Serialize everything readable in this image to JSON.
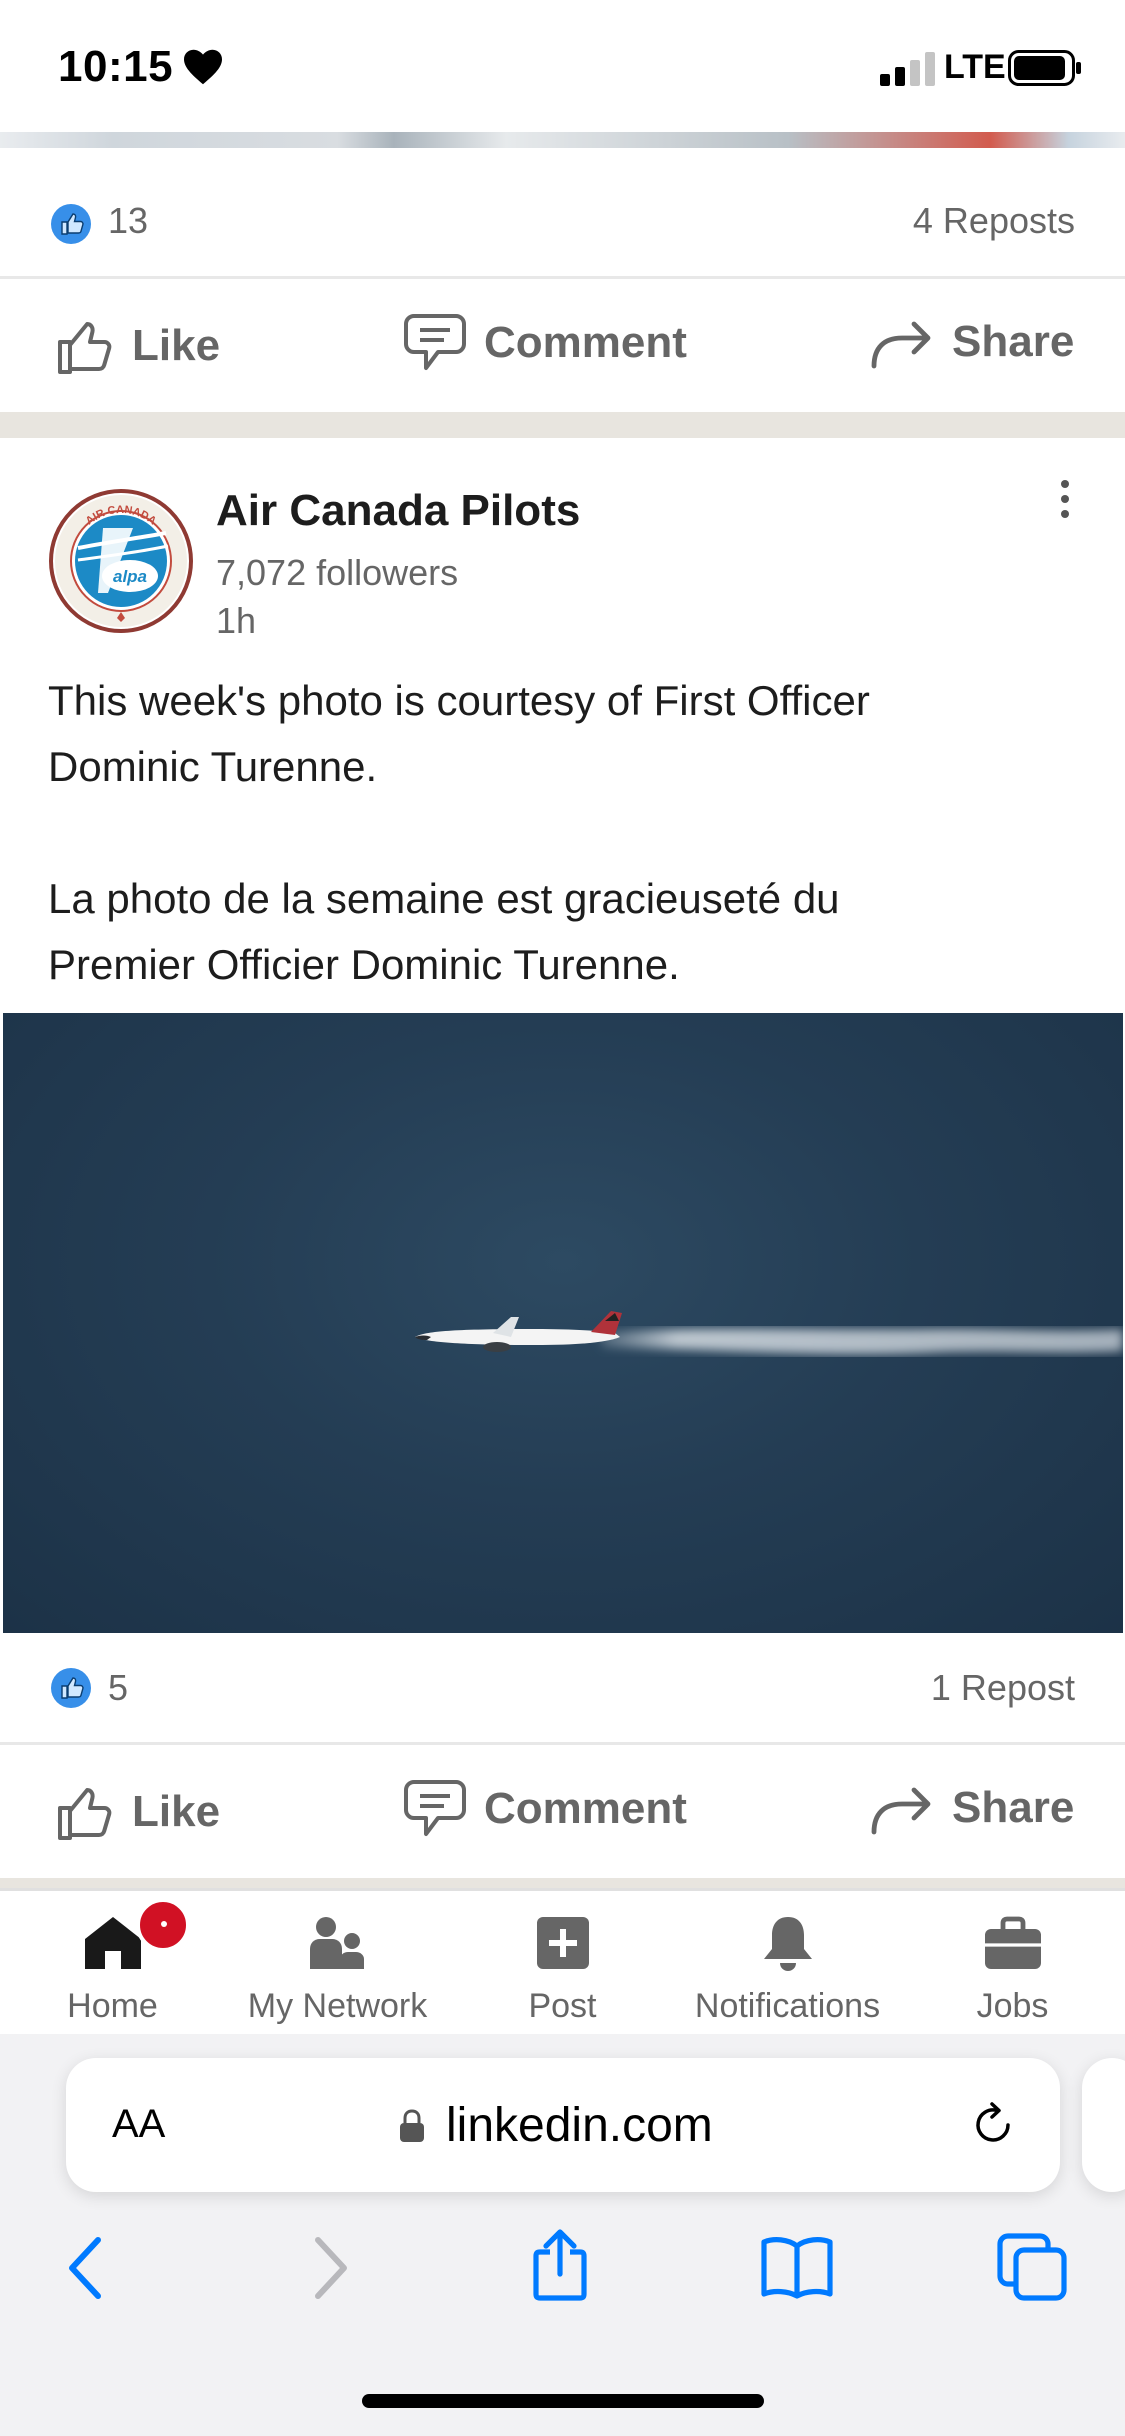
{
  "status_bar": {
    "time": "10:15",
    "network": "LTE"
  },
  "previous_post": {
    "reactions_count": "13",
    "reposts": "4 Reposts"
  },
  "actions": {
    "like": "Like",
    "comment": "Comment",
    "share": "Share"
  },
  "post": {
    "author": "Air Canada Pilots",
    "followers": "7,072 followers",
    "time": "1h",
    "avatar_ring_text": "AIR CANADA",
    "avatar_logo_text": "alpa",
    "text_en_line1": "This week's photo is courtesy of First Officer",
    "text_en_line2": "Dominic Turenne.",
    "text_fr_line1": "La photo de la semaine est gracieuseté du",
    "text_fr_line2": "Premier Officier Dominic Turenne.",
    "reactions_count": "5",
    "reposts": "1 Repost"
  },
  "bottom_nav": {
    "items": [
      {
        "label": "Home",
        "icon": "home-icon"
      },
      {
        "label": "My Network",
        "icon": "network-icon"
      },
      {
        "label": "Post",
        "icon": "post-icon"
      },
      {
        "label": "Notifications",
        "icon": "bell-icon"
      },
      {
        "label": "Jobs",
        "icon": "briefcase-icon"
      }
    ]
  },
  "safari": {
    "aa_label": "AA",
    "url": "linkedin.com"
  },
  "colors": {
    "linkedin_blue": "#0a66c2",
    "badge_red": "#d11124",
    "safari_blue": "#007aff",
    "text_muted": "#666666"
  }
}
